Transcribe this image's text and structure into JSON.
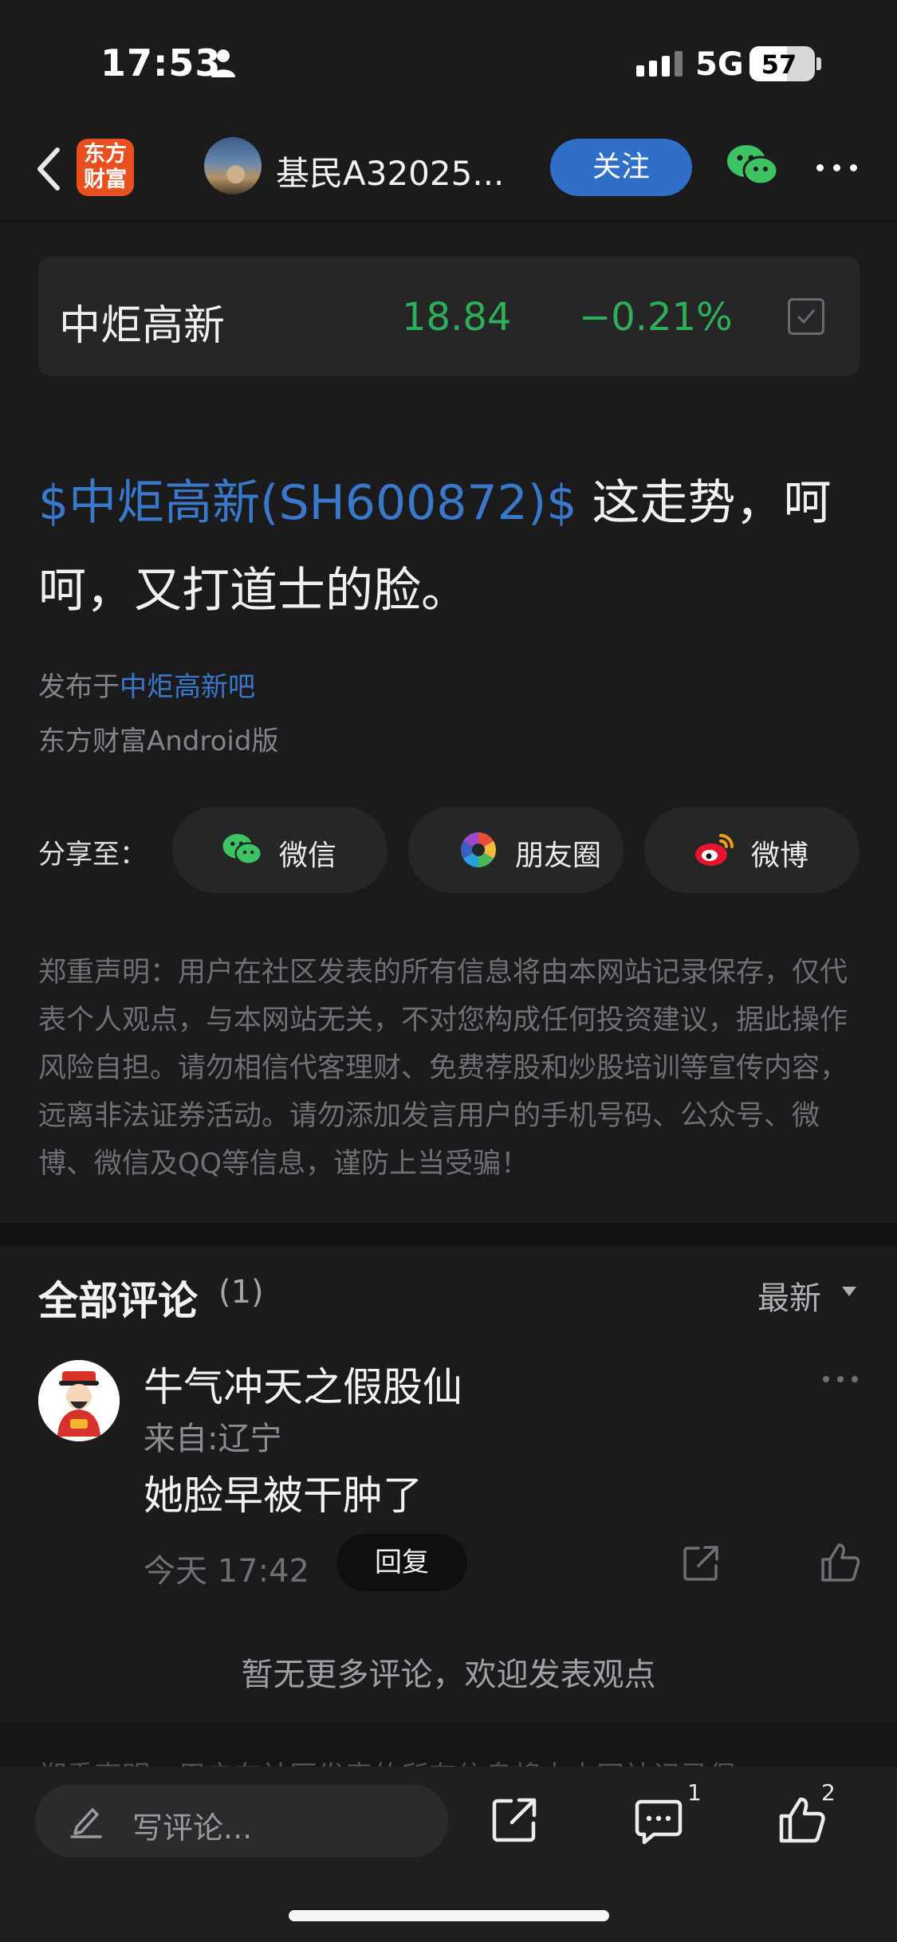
{
  "status_bar": {
    "time": "17:53",
    "network": "5G",
    "battery": "57",
    "battery_level": 0.57
  },
  "nav": {
    "logo_text_line1": "东方",
    "logo_text_line2": "财富",
    "username": "基民A32025...",
    "follow_label": "关注"
  },
  "stock": {
    "name": "中炬高新",
    "price": "18.84",
    "change": "−0.21%",
    "color": "#2fae5a"
  },
  "post": {
    "tag": "$中炬高新(SH600872)$",
    "body": " 这走势，呵呵，又打道士的脸。",
    "published_prefix": "发布于",
    "board": "中炬高新吧",
    "client": "东方财富Android版"
  },
  "share": {
    "label": "分享至：",
    "targets": [
      {
        "label": "微信",
        "icon": "wechat-icon"
      },
      {
        "label": "朋友圈",
        "icon": "moments-icon"
      },
      {
        "label": "微博",
        "icon": "weibo-icon"
      }
    ]
  },
  "disclaimer": "郑重声明：用户在社区发表的所有信息将由本网站记录保存，仅代表个人观点，与本网站无关，不对您构成任何投资建议，据此操作风险自担。请勿相信代客理财、免费荐股和炒股培训等宣传内容，远离非法证券活动。请勿添加发言用户的手机号码、公众号、微博、微信及QQ等信息，谨防上当受骗！",
  "comments": {
    "title": "全部评论",
    "count": "(1)",
    "sort": "最新",
    "items": [
      {
        "name": "牛气冲天之假股仙",
        "location": "来自:辽宁",
        "text": "她脸早被干肿了",
        "time": "今天 17:42",
        "reply_label": "回复"
      }
    ],
    "no_more": "暂无更多评论，欢迎发表观点"
  },
  "footer_peek": "郑重声明：用户在社区发表的所有信息将由本网站记录保",
  "bottom_bar": {
    "placeholder": "写评论...",
    "comment_count": "1",
    "like_count": "2"
  },
  "colors": {
    "accent_blue": "#2f6fc8",
    "link_blue": "#3a78c9",
    "down_green": "#2fae5a",
    "brand_orange": "#e8511f"
  }
}
